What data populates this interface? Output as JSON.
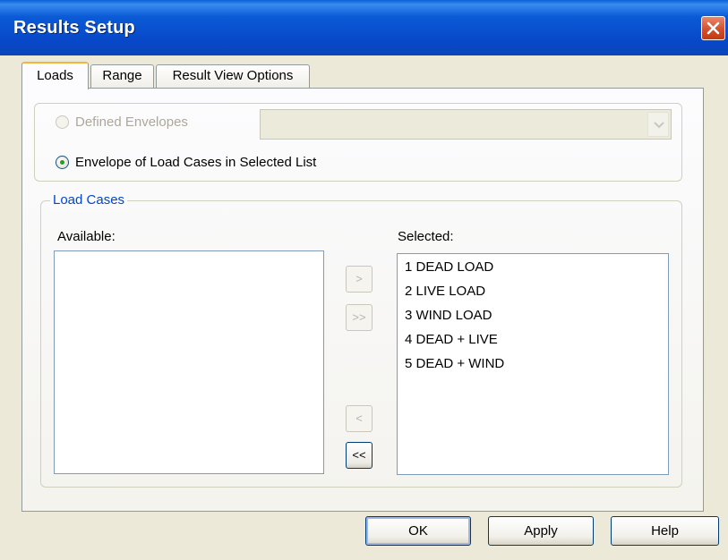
{
  "window": {
    "title": "Results Setup"
  },
  "tabs": [
    {
      "label": "Loads",
      "active": true
    },
    {
      "label": "Range",
      "active": false
    },
    {
      "label": "Result View Options",
      "active": false
    }
  ],
  "envelope_group": {
    "defined_envelopes": {
      "label": "Defined Envelopes",
      "checked": false,
      "enabled": false
    },
    "defined_envelopes_combo": {
      "value": "",
      "enabled": false
    },
    "selected_list": {
      "label": "Envelope of Load Cases in Selected List",
      "checked": true,
      "enabled": true
    }
  },
  "load_cases": {
    "title": "Load Cases",
    "available_label": "Available:",
    "selected_label": "Selected:",
    "available_items": [],
    "selected_items": [
      "1 DEAD LOAD",
      "2 LIVE LOAD",
      "3 WIND LOAD",
      "4 DEAD + LIVE",
      "5 DEAD + WIND"
    ],
    "move_buttons": {
      "add": {
        "label": ">",
        "enabled": false
      },
      "add_all": {
        "label": ">>",
        "enabled": false
      },
      "remove": {
        "label": "<",
        "enabled": false
      },
      "remove_all": {
        "label": "<<",
        "enabled": true
      }
    }
  },
  "buttons": {
    "ok": "OK",
    "apply": "Apply",
    "help": "Help"
  },
  "colors": {
    "title_bar": "#0a5ad6",
    "group_title": "#0046d5",
    "close_button": "#d3502d",
    "radio_dot": "#21a121"
  }
}
